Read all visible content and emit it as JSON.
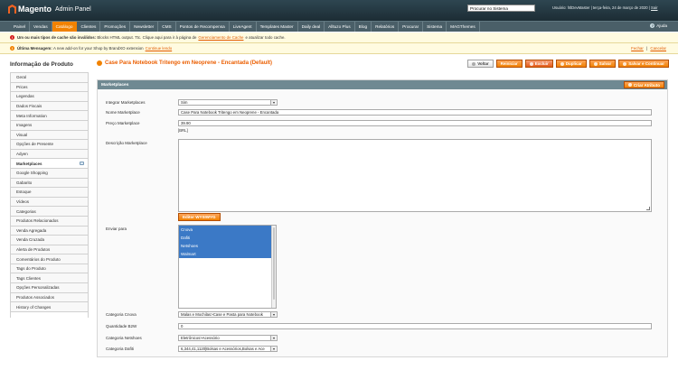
{
  "header": {
    "logo": "Magento",
    "logo_sub": "Admin Panel",
    "search_value": "Procurar no Sistema",
    "user_text": "Usuário: htlDevMaster",
    "date_text": "| terça-feira, 24 de março de 2020 |",
    "logout": "Sair"
  },
  "nav": {
    "items": [
      "Painel",
      "Vendas",
      "Catálogo",
      "Clientes",
      "Promoções",
      "Newsletter",
      "CMS",
      "Pontos de Recompensa",
      "LiveAgent",
      "Templates Master",
      "Daily deal",
      "Alltuzo Plus",
      "Blog",
      "Relatórios",
      "Procurar",
      "Sistema",
      "MAGThemes"
    ],
    "active_index": 2,
    "help": "Ajuda"
  },
  "messages": {
    "cache_strong": "Um ou mais tipos de cache são inválidos:",
    "cache_text": "Blocks HTML output. Ttc. Clique aqui para ir à página de",
    "cache_link": "Gerenciamento de Cache",
    "cache_tail": "e atualizar todo cache.",
    "latest_strong": "Última Mensagem:",
    "latest_text": "A new add-on for your Shop by BrandXO extension",
    "latest_link": "Continue lendo",
    "latest_right_1": "Fechar",
    "latest_right_sep": "|",
    "latest_right_2": "Cancelar"
  },
  "sidebar": {
    "title": "Informação de Produto",
    "tabs": [
      "Geral",
      "Prices",
      "Legendas",
      "Dados Fiscais",
      "Meta Information",
      "Imagens",
      "Visual",
      "Opções de Presente",
      "Adyen",
      "Marketplaces",
      "Google Shopping",
      "Gabarito",
      "Estoque",
      "Vídeos",
      "Categorias",
      "Produtos Relacionados",
      "Venda Agregada",
      "Venda Cruzada",
      "Alerta de Produtos",
      "Comentários do Produto",
      "Tags do Produto",
      "Tags Clientes",
      "Opções Personalizadas",
      "Produtos Associados",
      "History of Changes"
    ],
    "active_index": 9
  },
  "content": {
    "title": "Case Para Notebook Tritengo em Neoprene - Encantada (Default)",
    "buttons": {
      "back": "Voltar",
      "reset": "Reiniciar",
      "delete": "Excluir",
      "duplicate": "Duplicar",
      "save": "Salvar",
      "save_continue": "Salvar e Continuar"
    },
    "panel_title": "Marketplaces",
    "create_attr": "Criar Atributo",
    "fields": {
      "integrar_label": "Integrar Marketplaces",
      "integrar_value": "Sim",
      "nome_label": "Nome Marketplace",
      "nome_value": "Case Para Notebook Tritengo em Neoprene - Encantada",
      "preco_label": "Preço Marketplace",
      "preco_value": "39.90",
      "preco_note": "[BRL]",
      "descricao_label": "Descrição Marketplace",
      "wysiwyg": "Editor WYSIWYG",
      "enviar_label": "Enviar para",
      "enviar_options": [
        "Cnova",
        "Dafiti",
        "Netshoes",
        "Walmart"
      ],
      "cat_cnova_label": "Categoria Cnova",
      "cat_cnova_value": "Malas e Mochilas>Case e Pasta para Notebook",
      "qtd_label": "Quantidade B2W",
      "qtd_value": "0",
      "cat_netshoes_label": "Categoria Netshoes",
      "cat_netshoes_value": "Eletrônicos>Acessório",
      "cat_dafiti_label": "Categoria Dafiti",
      "cat_dafiti_value": "6,344,41,1120|Bolsas e Acessórios,Bolsas e Ace"
    }
  },
  "colors": {
    "accent": "#f18200",
    "header": "#24363f",
    "nav": "#4a5f68",
    "title": "#eb5e00",
    "selected": "#3b79c6"
  }
}
